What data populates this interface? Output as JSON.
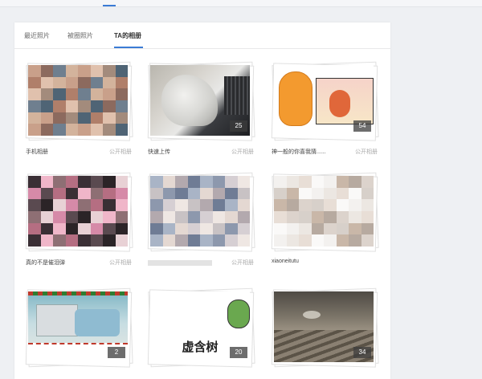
{
  "tabs": [
    {
      "label": "最近照片",
      "active": false
    },
    {
      "label": "被圈照片",
      "active": false
    },
    {
      "label": "TA的相册",
      "active": true
    }
  ],
  "albums": [
    {
      "name": "手机相册",
      "visibility": "公开相册",
      "count": ""
    },
    {
      "name": "快速上传",
      "visibility": "公开相册",
      "count": "25"
    },
    {
      "name": "神一般的你喜我猜......",
      "visibility": "公开相册",
      "count": "54"
    },
    {
      "name": "真的不是催泪弹",
      "visibility": "公开相册",
      "count": ""
    },
    {
      "name": "",
      "visibility": "公开相册",
      "count": ""
    },
    {
      "name": "xiaoneitutu",
      "visibility": "",
      "count": ""
    },
    {
      "name": "",
      "visibility": "",
      "count": "2"
    },
    {
      "name": "",
      "visibility": "",
      "count": "20",
      "cover_text": "虚含树"
    },
    {
      "name": "",
      "visibility": "",
      "count": "34"
    }
  ],
  "colors": {
    "accent": "#3a7bd5"
  }
}
